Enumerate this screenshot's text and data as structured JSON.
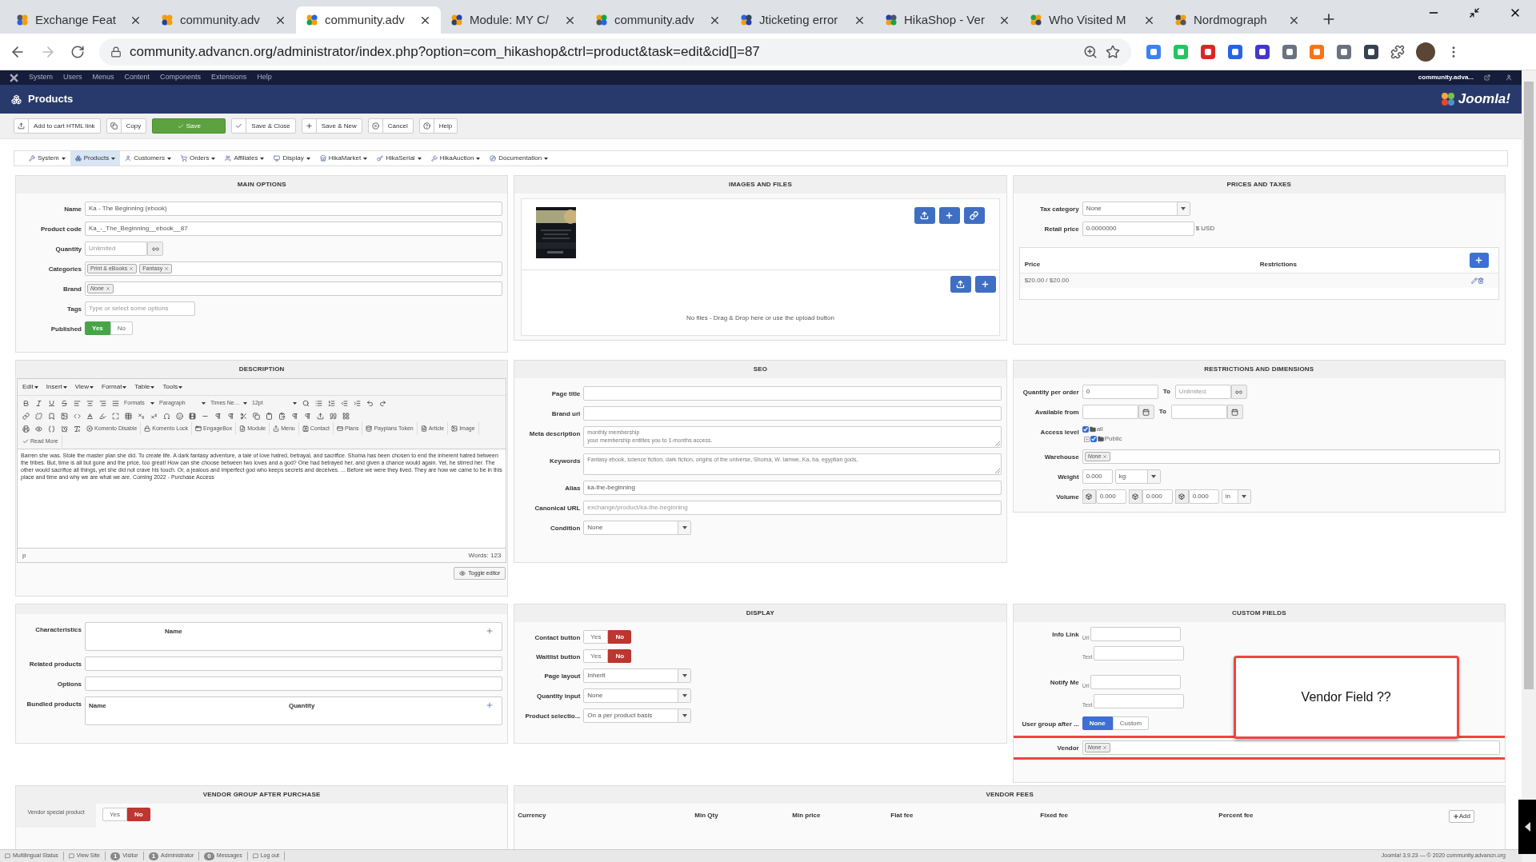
{
  "browser": {
    "tabs": [
      {
        "title": "Exchange Feat",
        "selected": false
      },
      {
        "title": "community.adv",
        "selected": false
      },
      {
        "title": "community.adv",
        "selected": true
      },
      {
        "title": "Module: MY C/",
        "selected": false
      },
      {
        "title": "community.adv",
        "selected": false
      },
      {
        "title": "Jticketing error",
        "selected": false
      },
      {
        "title": "HikaShop - Ver",
        "selected": false
      },
      {
        "title": "Who Visited M",
        "selected": false
      },
      {
        "title": "Nordmograph",
        "selected": false
      }
    ],
    "url": "community.advancn.org/administrator/index.php?option=com_hikashop&ctrl=product&task=edit&cid[]=87"
  },
  "admin_menu": {
    "items": [
      "System",
      "Users",
      "Menus",
      "Content",
      "Components",
      "Extensions",
      "Help"
    ],
    "site_name": "community.adva..."
  },
  "header": {
    "title": "Products",
    "logo_text": "Joomla!"
  },
  "toolbar": [
    {
      "label": "Add to cart HTML link",
      "kind": "default"
    },
    {
      "label": "Copy",
      "kind": "default"
    },
    {
      "label": "Save",
      "kind": "primary"
    },
    {
      "label": "Save & Close",
      "kind": "default"
    },
    {
      "label": "Save & New",
      "kind": "default"
    },
    {
      "label": "Cancel",
      "kind": "default"
    },
    {
      "label": "Help",
      "kind": "default"
    }
  ],
  "submenu": [
    {
      "label": "System",
      "selected": false
    },
    {
      "label": "Products",
      "selected": true
    },
    {
      "label": "Customers",
      "selected": false
    },
    {
      "label": "Orders",
      "selected": false
    },
    {
      "label": "Affiliates",
      "selected": false
    },
    {
      "label": "Display",
      "selected": false
    },
    {
      "label": "HikaMarket",
      "selected": false
    },
    {
      "label": "HikaSerial",
      "selected": false
    },
    {
      "label": "HikaAuction",
      "selected": false
    },
    {
      "label": "Documentation",
      "selected": false
    }
  ],
  "main_options": {
    "title": "MAIN OPTIONS",
    "fields": [
      {
        "label": "Name",
        "kind": "text",
        "value": "Ka - The Beginning (ebook)"
      },
      {
        "label": "Product code",
        "kind": "text",
        "value": "Ka_-_The_Beginning__ebook__87"
      },
      {
        "label": "Quantity",
        "kind": "unlimited",
        "placeholder": "Unlimited"
      },
      {
        "label": "Categories",
        "kind": "tags",
        "tags": [
          {
            "label": "Print & eBooks",
            "empty": false
          },
          {
            "label": "Fantasy",
            "empty": false
          }
        ]
      },
      {
        "label": "Brand",
        "kind": "tags",
        "tags": [
          {
            "label": "None",
            "empty": true
          }
        ]
      },
      {
        "label": "Tags",
        "kind": "short_text",
        "placeholder": "Type or select some options"
      },
      {
        "label": "Published",
        "kind": "toggle",
        "color": "#46a546",
        "options": [
          {
            "label": "Yes",
            "selected": true
          },
          {
            "label": "No",
            "selected": false
          }
        ]
      }
    ]
  },
  "images_and_files": {
    "title": "IMAGES AND FILES",
    "files_message": "No files - Drag & Drop here or use the upload button"
  },
  "prices_and_taxes": {
    "title": "PRICES AND TAXES",
    "fields": [
      {
        "label": "Tax category",
        "kind": "select",
        "value": "None"
      },
      {
        "label": "Retail price",
        "kind": "price",
        "value": "0.0000000",
        "unit": "$ USD"
      }
    ],
    "price_table": {
      "columns": [
        "Price",
        "Restrictions"
      ],
      "rows": [
        {
          "price": "$20.00 / $20.00"
        }
      ]
    }
  },
  "description": {
    "title": "DESCRIPTION",
    "menus": [
      "Edit",
      "Insert",
      "View",
      "Format",
      "Table",
      "Tools"
    ],
    "dropdowns": [
      "Formats",
      "Paragraph",
      "Times Ne…",
      "12pt"
    ],
    "plugin_buttons": [
      "Komento Disable",
      "Komento Lock",
      "EngageBox",
      "Module",
      "Menu",
      "Contact",
      "Plans",
      "Payplans Token",
      "Article",
      "Image",
      "Read More"
    ],
    "body": "Barren she was. Stole the master plan she did. To create life. A dark fantasy adventure, a tale of love hatred, betrayal, and sacrifice. Shoma has been chosen to end the inherent hatred between the tribes. But, time is all but gone and the price, too great! How can she choose between two loves and a god? One had betrayed her, and given a chance would again. Yet, he stirred her. The other would sacrifice all things, yet she did not crave his touch. Or, a jealous and imperfect god who keeps secrets and deceives. ... Before we were they lived. They are how we came to be in this place and time and why we are what we are. Coming 2022 - Purchase Access",
    "path": "p",
    "word_count": "Words: 123",
    "toggle_button": "Toggle editor"
  },
  "seo": {
    "title": "SEO",
    "fields": [
      {
        "label": "Page title",
        "kind": "text"
      },
      {
        "label": "Brand url",
        "kind": "text"
      },
      {
        "label": "Meta description",
        "kind": "textarea",
        "value": "monthly membership\nyour membership entitles you to 1-months access."
      },
      {
        "label": "Keywords",
        "kind": "textarea",
        "value": "Fantasy ebook, science fiction, dark fiction, origins of the universe, Shoma, W. Iamwe, Ka, ba, egyptian gods,"
      },
      {
        "label": "Alias",
        "kind": "text",
        "value": "ka-the-beginning"
      },
      {
        "label": "Canonical URL",
        "kind": "text",
        "placeholder": "exchange/product/ka-the-beginning"
      },
      {
        "label": "Condition",
        "kind": "select",
        "value": "None"
      }
    ]
  },
  "restrictions": {
    "title": "RESTRICTIONS AND DIMENSIONS",
    "fields": [
      {
        "label": "Quantity per order",
        "kind": "range",
        "value": "0",
        "separator": "To",
        "placeholder": "Unlimited"
      },
      {
        "label": "Available from",
        "kind": "date_range",
        "separator": "To"
      },
      {
        "label": "Access level",
        "kind": "tree",
        "items": [
          {
            "label": "all",
            "checked": true,
            "children": [
              {
                "label": "Public",
                "checked": true
              }
            ]
          }
        ]
      },
      {
        "label": "Warehouse",
        "kind": "tags",
        "tags": [
          {
            "label": "None",
            "empty": true
          }
        ]
      },
      {
        "label": "Weight",
        "kind": "measure",
        "value": "0.000",
        "unit": "kg"
      },
      {
        "label": "Volume",
        "kind": "volume",
        "values": [
          "0.000",
          "0.000",
          "0.000"
        ],
        "unit": "in"
      }
    ]
  },
  "related": {
    "fields": [
      {
        "label": "Characteristics",
        "kind": "subtable",
        "columns": [
          "Name"
        ]
      },
      {
        "label": "Related products",
        "kind": "text"
      },
      {
        "label": "Options",
        "kind": "text"
      },
      {
        "label": "Bundled products",
        "kind": "subtable",
        "columns": [
          "Name",
          "Quantity"
        ]
      }
    ]
  },
  "display": {
    "title": "DISPLAY",
    "fields": [
      {
        "label": "Contact button",
        "kind": "toggle",
        "color": "#bd362f",
        "options": [
          {
            "label": "Yes",
            "selected": false
          },
          {
            "label": "No",
            "selected": true
          }
        ]
      },
      {
        "label": "Waitlist button",
        "kind": "toggle",
        "color": "#bd362f",
        "options": [
          {
            "label": "Yes",
            "selected": false
          },
          {
            "label": "No",
            "selected": true
          }
        ]
      },
      {
        "label": "Page layout",
        "kind": "select",
        "value": "Inherit"
      },
      {
        "label": "Quantity input",
        "kind": "select",
        "value": "None"
      },
      {
        "label": "Product selectio...",
        "kind": "select",
        "value": "On a per product basis"
      }
    ]
  },
  "custom_fields": {
    "title": "CUSTOM FIELDS",
    "fields": [
      {
        "label": "Info Link",
        "kind": "link",
        "parts": [
          "Url",
          "Text"
        ],
        "highlighted": false
      },
      {
        "label": "Notify Me",
        "kind": "link",
        "parts": [
          "Url",
          "Text"
        ],
        "highlighted": false
      },
      {
        "label": "User group after ...",
        "kind": "toggle",
        "color": "#3d6fd4",
        "options": [
          {
            "label": "None",
            "selected": true
          },
          {
            "label": "Custom",
            "selected": false
          }
        ],
        "highlighted": false
      },
      {
        "label": "Vendor",
        "kind": "tags",
        "tags": [
          {
            "label": "None",
            "empty": true
          }
        ],
        "highlighted": true
      }
    ],
    "annotation": "Vendor Field ??"
  },
  "vendor_group": {
    "title": "VENDOR GROUP AFTER PURCHASE",
    "label": "Vendor special product",
    "color": "#bd362f",
    "options": [
      {
        "label": "Yes",
        "selected": false
      },
      {
        "label": "No",
        "selected": true
      }
    ]
  },
  "vendor_fees": {
    "title": "VENDOR FEES",
    "columns": [
      "Currency",
      "Min Qty",
      "Min price",
      "Flat fee",
      "Fixed fee",
      "Percent fee"
    ],
    "add_button": "Add"
  },
  "status_bar": {
    "items": [
      {
        "label": "Multilingual Status"
      },
      {
        "label": "View Site"
      },
      {
        "count": "1",
        "label": "Visitor"
      },
      {
        "count": "1",
        "label": "Administrator"
      },
      {
        "count": "0",
        "label": "Messages"
      },
      {
        "label": "Log out"
      }
    ],
    "version": "Joomla! 3.9.23 — © 2020 community.advancn.org"
  }
}
